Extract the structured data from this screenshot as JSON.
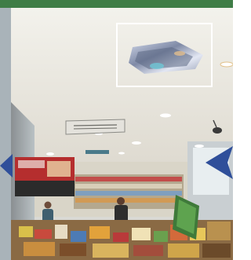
{
  "scene": {
    "description_label": "",
    "store_sign_text": "",
    "colors": {
      "header_band": "#3f7d46",
      "ceiling": "#efeee8",
      "arrow_blue": "#2f4f9a",
      "highlight_box": "#ffffff"
    },
    "icons": [
      "ceiling-light-fixture-icon",
      "left-arrow-icon",
      "right-arrow-icon"
    ]
  }
}
